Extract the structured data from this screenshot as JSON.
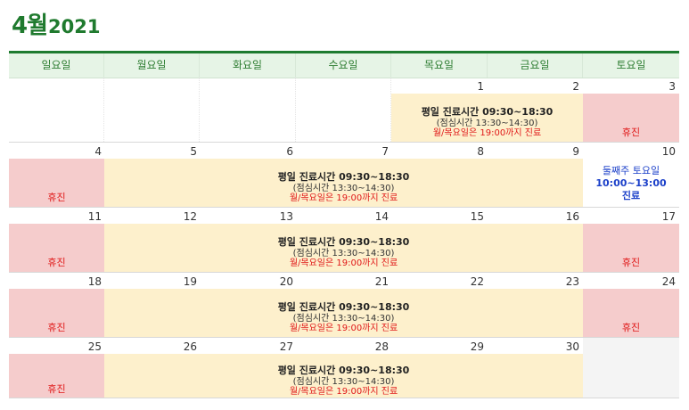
{
  "title": {
    "month": "4월",
    "year": "2021"
  },
  "headers": [
    "일요일",
    "월요일",
    "화요일",
    "수요일",
    "목요일",
    "금요일",
    "토요일"
  ],
  "weeks": [
    {
      "days": [
        "",
        "",
        "",
        "",
        "1",
        "2",
        "3"
      ]
    },
    {
      "days": [
        "4",
        "5",
        "6",
        "7",
        "8",
        "9",
        "10"
      ]
    },
    {
      "days": [
        "11",
        "12",
        "13",
        "14",
        "15",
        "16",
        "17"
      ]
    },
    {
      "days": [
        "18",
        "19",
        "20",
        "21",
        "22",
        "23",
        "24"
      ]
    },
    {
      "days": [
        "25",
        "26",
        "27",
        "28",
        "29",
        "30",
        ""
      ]
    }
  ],
  "event": {
    "line1": "평일 진료시간 09:30~18:30",
    "line2": "(점심시간 13:30~14:30)",
    "line3": "월/목요일은 19:00까지 진료"
  },
  "closed_label": "휴진",
  "saturday_event": {
    "line1": "둘째주 토요일",
    "line2": "10:00~13:00",
    "line3": "진료"
  },
  "colors": {
    "accent": "#1e7b30",
    "weekday_bg": "#fdf0cc",
    "closed_bg": "#f5cccc",
    "closed_text": "#e01818",
    "saturday_text": "#1a3fc9"
  }
}
